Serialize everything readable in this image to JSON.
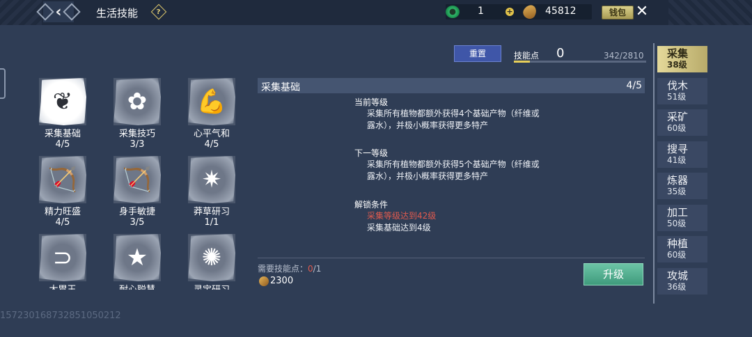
{
  "header": {
    "title": "生活技能",
    "help_glyph": "?",
    "jade_count": "1",
    "plus_glyph": "+",
    "coin_count": "45812",
    "wallet_label": "钱包"
  },
  "skill_points": {
    "reset_label": "重置",
    "label": "技能点",
    "value": "0",
    "progress_text": "342/2810",
    "progress_fraction": 0.1217
  },
  "skills": [
    {
      "name": "采集基础",
      "level": "4/5",
      "icon": "herb-leaves-icon",
      "glyph": "❦",
      "selected": true
    },
    {
      "name": "采集技巧",
      "level": "3/3",
      "icon": "flower-branch-icon",
      "glyph": "✿"
    },
    {
      "name": "心平气和",
      "level": "4/5",
      "icon": "muscle-arm-icon",
      "glyph": "💪"
    },
    {
      "name": "精力旺盛",
      "level": "4/5",
      "icon": "bow-icon",
      "glyph": "🏹"
    },
    {
      "name": "身手敏捷",
      "level": "3/5",
      "icon": "bow-icon",
      "glyph": "🏹"
    },
    {
      "name": "莽草研习",
      "level": "1/1",
      "icon": "star-grass-icon",
      "glyph": "✷"
    },
    {
      "name": "大胃王",
      "level": "",
      "icon": "stomach-icon",
      "glyph": "⊃"
    },
    {
      "name": "耐心聪慧",
      "level": "",
      "icon": "star-banner-icon",
      "glyph": "★"
    },
    {
      "name": "灵宝研习",
      "level": "",
      "icon": "constellation-icon",
      "glyph": "✺"
    }
  ],
  "detail": {
    "title": "采集基础",
    "level": "4/5",
    "current_label": "当前等级",
    "current_text": "采集所有植物都额外获得4个基础产物（纤维或露水），并极小概率获得更多特产",
    "next_label": "下一等级",
    "next_text": "采集所有植物都额外获得5个基础产物（纤维或露水），并极小概率获得更多特产",
    "unlock_label": "解锁条件",
    "unlock_req_1": "采集等级达到42级",
    "unlock_req_2": "采集基础达到4级",
    "cost_label": "需要技能点：",
    "cost_current": "0",
    "cost_total": "/1",
    "coin_cost": "2300",
    "upgrade_label": "升级"
  },
  "nav": [
    {
      "name": "采集",
      "level": "38级",
      "active": true
    },
    {
      "name": "伐木",
      "level": "51级"
    },
    {
      "name": "采矿",
      "level": "60级"
    },
    {
      "name": "搜寻",
      "level": "41级"
    },
    {
      "name": "炼器",
      "level": "35级"
    },
    {
      "name": "加工",
      "level": "50级"
    },
    {
      "name": "种植",
      "level": "60级"
    },
    {
      "name": "攻城",
      "level": "36级"
    }
  ],
  "footer": {
    "id_text": "1572301687328510502​12"
  }
}
